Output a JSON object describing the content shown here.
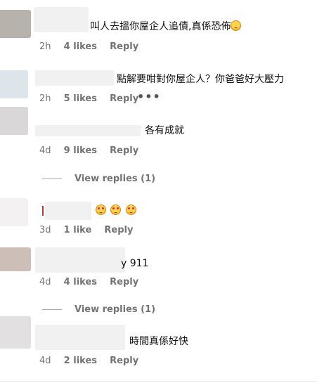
{
  "comments": [
    {
      "text": "叫人去搵你屋企人追債,真係恐佈",
      "emoji": "sad",
      "time": "2h",
      "likes": "4 likes",
      "reply": "Reply"
    },
    {
      "text": "點解要咁對你屋企人？你爸爸好大壓力",
      "time": "2h",
      "likes": "5 likes",
      "reply": "Reply",
      "more": "•••"
    },
    {
      "text": "各有成就",
      "time": "4d",
      "likes": "9 likes",
      "reply": "Reply"
    },
    {
      "text": "",
      "emoji": "love",
      "time": "3d",
      "likes": "1 like",
      "reply": "Reply"
    },
    {
      "text": "y 911",
      "time": "4d",
      "likes": "4 likes",
      "reply": "Reply"
    },
    {
      "text": "時間真係好快",
      "time": "4d",
      "likes": "2 likes",
      "reply": "Reply"
    }
  ],
  "view_replies": [
    "View replies (1)",
    "View replies (1)"
  ],
  "colors": {
    "meta": "#737373",
    "text": "#111111",
    "avatar_tones": [
      "#b8b2ad",
      "#dde4ea",
      "#d9d7d8",
      "#ffffff",
      "#cdbfb7",
      "#e2e0e0"
    ]
  }
}
